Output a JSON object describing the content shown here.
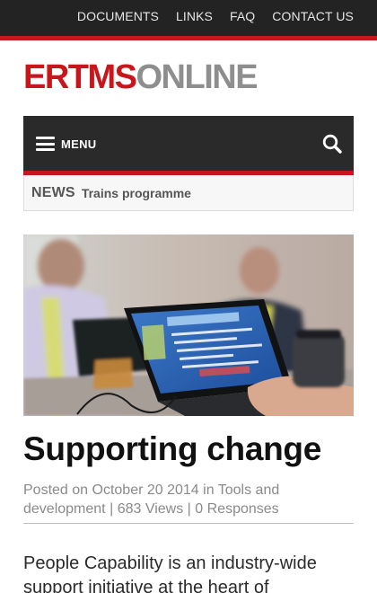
{
  "topnav": {
    "items": [
      "DOCUMENTS",
      "LINKS",
      "FAQ",
      "CONTACT US"
    ]
  },
  "logo": {
    "part1": "ERTMS",
    "part2": "ONLINE"
  },
  "menu": {
    "label": "MENU",
    "icon": "hamburger-icon",
    "search_icon": "search-icon"
  },
  "news": {
    "label": "NEWS",
    "headline": "Trains programme"
  },
  "hero": {
    "alt": "photo of people in a meeting using a laptop"
  },
  "post": {
    "title": "Supporting change",
    "meta_prefix": "Posted on October 20 2014 in ",
    "category": "Tools and development",
    "views": "683 Views",
    "responses": "0 Responses",
    "body": "People Capability is an industry-wide support initiative at the heart of"
  },
  "colors": {
    "brand_red": "#c8161d",
    "logo_grey": "#8e8e8e",
    "dark_bar": "#2a2a2a"
  }
}
